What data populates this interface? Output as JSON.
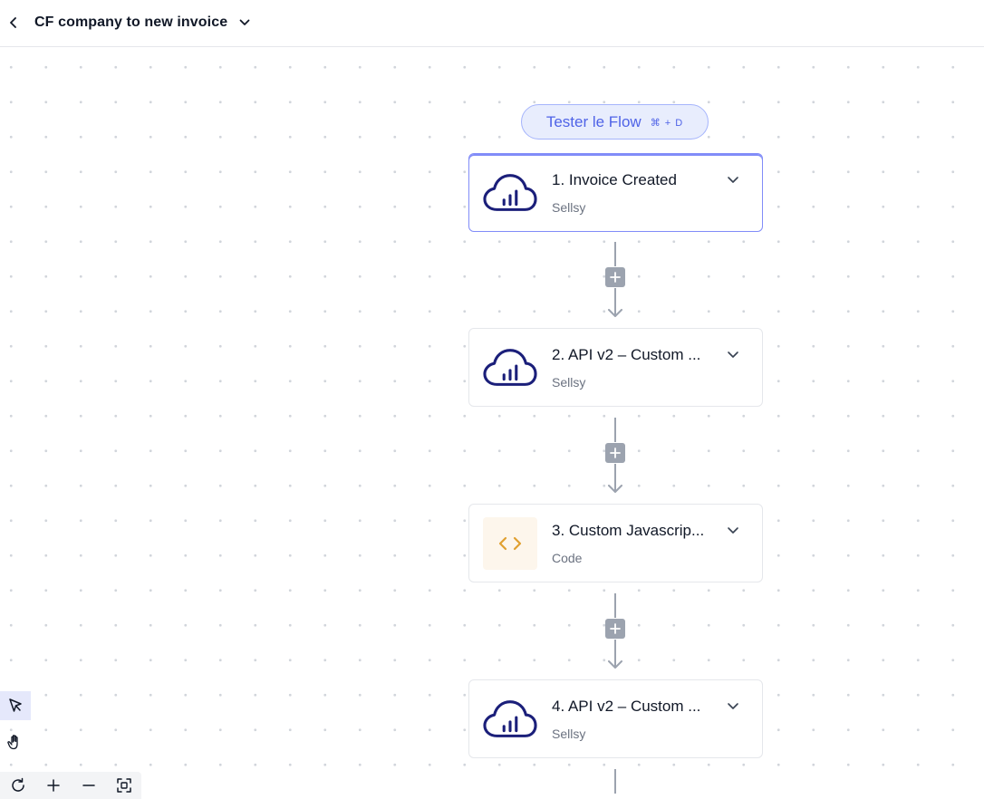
{
  "header": {
    "title": "CF company to new invoice",
    "back_icon": "chevron-left-icon",
    "dropdown_icon": "chevron-down-icon"
  },
  "test_flow": {
    "label": "Tester le Flow",
    "shortcut": "⌘ + D"
  },
  "steps": [
    {
      "title": "1. Invoice Created",
      "app": "Sellsy",
      "icon": "sellsy-cloud-icon",
      "selected": true
    },
    {
      "title": "2. API v2 – Custom ...",
      "app": "Sellsy",
      "icon": "sellsy-cloud-icon",
      "selected": false
    },
    {
      "title": "3. Custom Javascrip...",
      "app": "Code",
      "icon": "code-icon",
      "selected": false
    },
    {
      "title": "4. API v2 – Custom ...",
      "app": "Sellsy",
      "icon": "sellsy-cloud-icon",
      "selected": false
    }
  ],
  "toolbar": {
    "tools": [
      "pointer-icon",
      "hand-icon"
    ],
    "zoom_controls": [
      "refresh-icon",
      "zoom-in-icon",
      "zoom-out-icon",
      "fit-view-icon"
    ]
  },
  "colors": {
    "accent": "#4f63e7",
    "sellsy_brand": "#1b1f7a",
    "code_icon": "#e0a030",
    "connector": "#9ca3af"
  }
}
